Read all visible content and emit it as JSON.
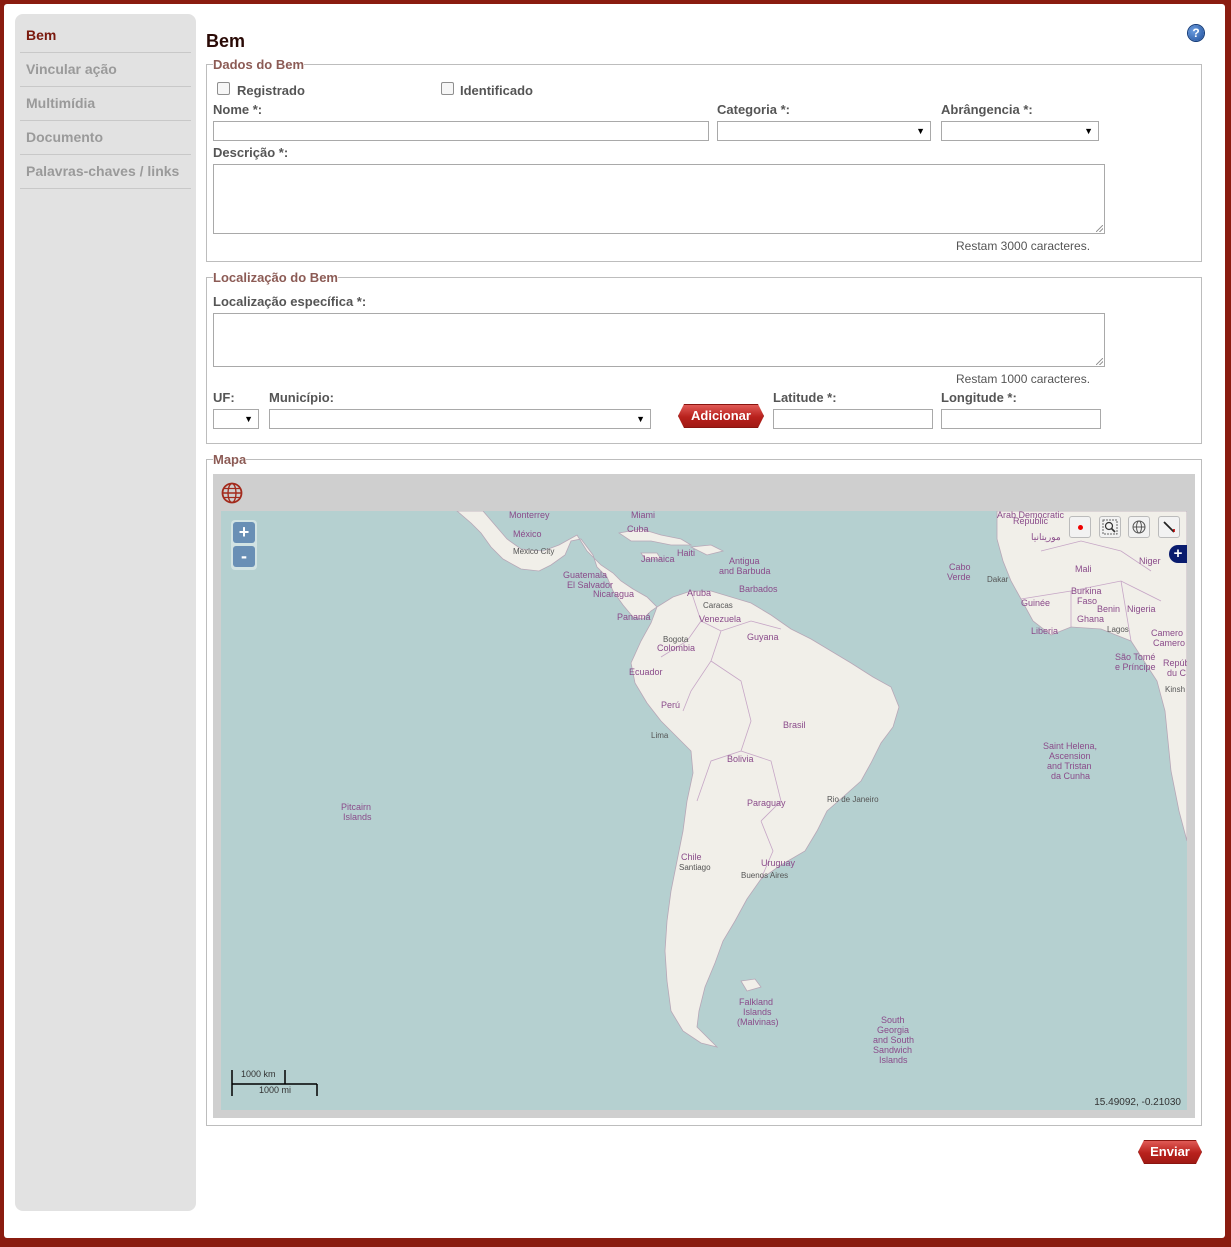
{
  "sidebar": {
    "items": [
      {
        "label": "Bem",
        "active": true
      },
      {
        "label": "Vincular ação",
        "active": false
      },
      {
        "label": "Multimídia",
        "active": false
      },
      {
        "label": "Documento",
        "active": false
      },
      {
        "label": "Palavras-chaves / links",
        "active": false
      }
    ]
  },
  "page": {
    "title": "Bem",
    "help_icon": "help-icon"
  },
  "dados": {
    "legend": "Dados do Bem",
    "registrado_label": "Registrado",
    "identificado_label": "Identificado",
    "nome_label": "Nome *:",
    "nome_value": "",
    "categoria_label": "Categoria *:",
    "categoria_value": "",
    "abrangencia_label": "Abrângencia *:",
    "abrangencia_value": "",
    "descricao_label": "Descrição *:",
    "descricao_value": "",
    "descricao_counter": "Restam 3000 caracteres."
  },
  "localizacao": {
    "legend": "Localização do Bem",
    "especifica_label": "Localização específica *:",
    "especifica_value": "",
    "especifica_counter": "Restam 1000 caracteres.",
    "uf_label": "UF:",
    "uf_value": "",
    "municipio_label": "Município:",
    "municipio_value": "",
    "adicionar_label": "Adicionar",
    "latitude_label": "Latitude *:",
    "latitude_value": "",
    "longitude_label": "Longitude *:",
    "longitude_value": ""
  },
  "mapa": {
    "legend": "Mapa",
    "zoom_in": "+",
    "zoom_out": "-",
    "layer_switch": "+",
    "scale_km": "1000 km",
    "scale_mi": "1000 mi",
    "coords": "15.49092, -0.21030",
    "places": [
      "Monterrey",
      "Miami",
      "México",
      "Mexico City",
      "Cuba",
      "Haiti",
      "Jamaica",
      "Antigua",
      "and Barbuda",
      "Guatemala",
      "El Salvador",
      "Nicaragua",
      "Barbados",
      "Aruba",
      "Caracas",
      "Panamá",
      "Venezuela",
      "Bogota",
      "Guyana",
      "Colombia",
      "Ecuador",
      "Perú",
      "Lima",
      "Brasil",
      "Bolivia",
      "Paraguay",
      "Rio de Janeiro",
      "Pitcairn",
      "Islands",
      "Chile",
      "Santiago",
      "Uruguay",
      "Buenos Aires",
      "Falkland",
      "Islands",
      "(Malvinas)",
      "South",
      "Georgia",
      "and South",
      "Sandwich",
      "Islands",
      "Cabo",
      "Verde",
      "Dakar",
      "Arab Democratic",
      "Republic",
      "موريتانيا",
      "Mali",
      "Niger",
      "Burkina",
      "Faso",
      "Guinée",
      "Benin",
      "Nigeria",
      "Ghana",
      "Lagos",
      "Liberia",
      "Camero",
      "Camero",
      "São Tomé",
      "e Príncipe",
      "Repúb",
      "du C",
      "Kinsh",
      "Saint Helena,",
      "Ascension",
      "and Tristan",
      "da Cunha"
    ]
  },
  "actions": {
    "enviar_label": "Enviar"
  },
  "colors": {
    "accent": "#8a1c10",
    "map_water": "#b5d0d0",
    "map_land": "#f1efe9"
  }
}
